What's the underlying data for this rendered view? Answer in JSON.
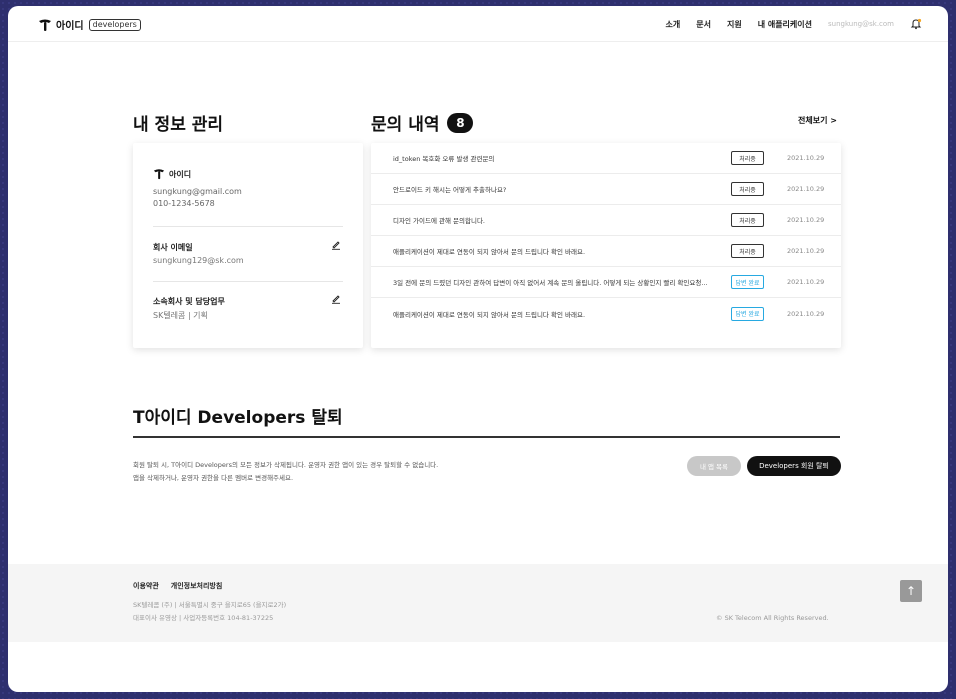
{
  "header": {
    "logo_text": "아이디",
    "logo_badge": "developers",
    "nav": [
      "소개",
      "문서",
      "지원",
      "내 애플리케이션"
    ],
    "user_email": "sungkung@sk.com"
  },
  "profile": {
    "heading": "내 정보 관리",
    "brand": "아이디",
    "email": "sungkung@gmail.com",
    "phone": "010-1234-5678",
    "company_email_label": "회사 이메일",
    "company_email": "sungkung129@sk.com",
    "affiliation_label": "소속회사 및 담당업무",
    "affiliation": "SK텔레콤 | 기획"
  },
  "inquiries": {
    "heading": "문의 내역",
    "count": "8",
    "view_all": "전체보기 >",
    "rows": [
      {
        "title": "id_token 복호화 오류 발생 관련문의",
        "status": "처리중",
        "date": "2021.10.29"
      },
      {
        "title": "안드로이드 키 해시는 어떻게 추출하나요?",
        "status": "처리중",
        "date": "2021.10.29"
      },
      {
        "title": "디자인 가이드에 관해 문의합니다.",
        "status": "처리중",
        "date": "2021.10.29"
      },
      {
        "title": "애플리케이션이 제대로 연동이 되지 않아서 문의 드립니다 확인 바래요.",
        "status": "처리중",
        "date": "2021.10.29"
      },
      {
        "title": "3일 전에 문의 드렸던 디자인 관하여 답변이 아직 없어서 계속 문의 올립니다. 어떻게 되는 상황인지 빨리 확인요청...",
        "status": "답변 완료",
        "date": "2021.10.29"
      },
      {
        "title": "애플리케이션이 제대로 연동이 되지 않아서 문의 드립니다 확인 바래요.",
        "status": "답변 완료",
        "date": "2021.10.29"
      }
    ]
  },
  "withdraw": {
    "heading": "T아이디 Developers 탈퇴",
    "text1": "회원 탈퇴 시, T아이디 Developers의 모든 정보가 삭제됩니다. 운영자 권한 앱이 있는 경우 탈퇴할 수 없습니다.",
    "text2": "앱을 삭제하거나, 운영자 권한을 다른 멤버로 변경해주세요.",
    "apps_button": "내 앱 목록",
    "withdraw_button": "Developers 회원 탈퇴"
  },
  "footer": {
    "links": [
      "이용약관",
      "개인정보처리방침"
    ],
    "address1": "SK텔레콤 (주) | 서울특별시 중구 을지로65 (을지로2가)",
    "address2": "대표이사 유영상 | 사업자등록번호 104-81-37225",
    "copyright": "© SK Telecom All Rights Reserved.",
    "to_top": "↑"
  },
  "colors": {
    "accent": "#27a9e1",
    "dark": "#111111",
    "background": "#2e2f6e"
  }
}
